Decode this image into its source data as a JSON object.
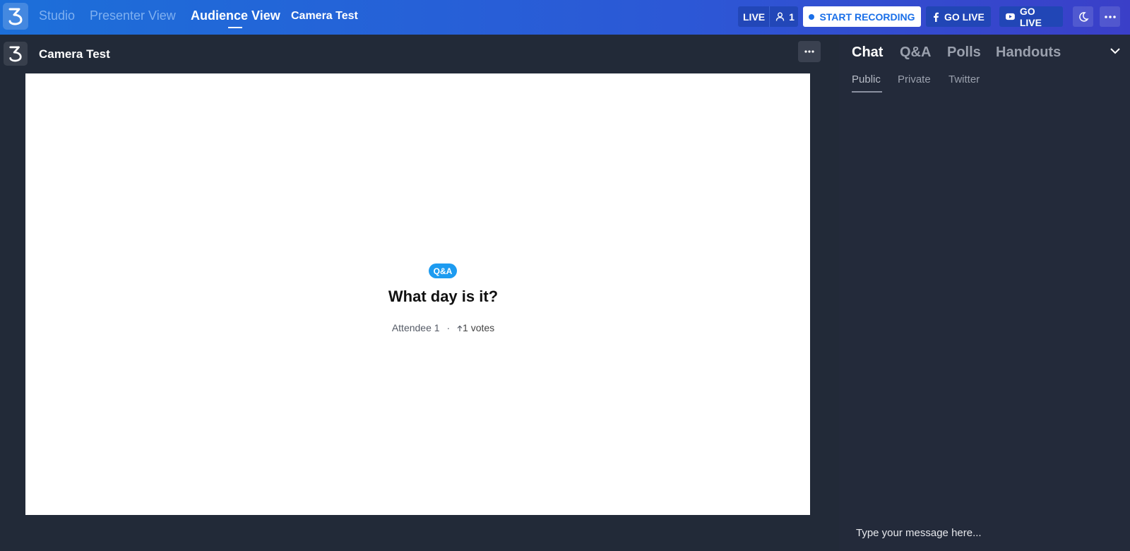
{
  "topbar": {
    "nav": {
      "studio": "Studio",
      "presenter": "Presenter View",
      "audience": "Audience View"
    },
    "event_title": "Camera Test",
    "live_label": "LIVE",
    "viewer_count": "1",
    "start_recording": "START RECORDING",
    "facebook_go_live": "GO LIVE",
    "youtube_go_live": "GO LIVE"
  },
  "subheader": {
    "title": "Camera Test"
  },
  "stage": {
    "badge": "Q&A",
    "question": "What day is it?",
    "author": "Attendee 1",
    "separator": "·",
    "votes": "1 votes"
  },
  "panel": {
    "tabs": {
      "chat": "Chat",
      "qa": "Q&A",
      "polls": "Polls",
      "handouts": "Handouts"
    },
    "subtabs": {
      "public": "Public",
      "private": "Private",
      "twitter": "Twitter"
    },
    "chat_placeholder": "Type your message here..."
  },
  "colors": {
    "accent": "#1a6fe8",
    "badge": "#1d9bf0",
    "background": "#222a38"
  }
}
